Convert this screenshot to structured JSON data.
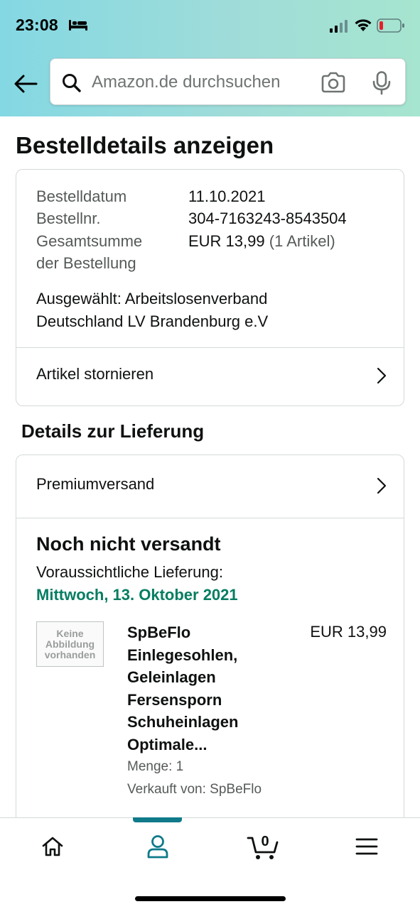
{
  "status_bar": {
    "time": "23:08"
  },
  "search": {
    "placeholder": "Amazon.de durchsuchen"
  },
  "page": {
    "title": "Bestelldetails anzeigen"
  },
  "order": {
    "date_label": "Bestelldatum",
    "date_value": "11.10.2021",
    "number_label": "Bestellnr.",
    "number_value": "304-7163243-8543504",
    "total_label_line1": "Gesamtsumme",
    "total_label_line2": "der Bestellung",
    "total_value": "EUR 13,99",
    "total_items": "(1 Artikel)",
    "selected_line1": "Ausgewählt: Arbeitslosenverband",
    "selected_line2": "Deutschland LV Brandenburg e.V",
    "cancel_link": "Artikel stornieren"
  },
  "delivery": {
    "section_title": "Details zur Lieferung",
    "shipping_method": "Premiumversand",
    "status": "Noch nicht versandt",
    "expected_label": "Voraussichtliche Lieferung:",
    "expected_date": "Mittwoch, 13. Oktober 2021"
  },
  "item": {
    "image_placeholder_line1": "Keine",
    "image_placeholder_line2": "Abbildung",
    "image_placeholder_line3": "vorhanden",
    "title_lines": [
      "SpBeFlo",
      "Einlegesohlen,",
      "Geleinlagen",
      "Fersensporn",
      "Schuheinlagen",
      "Optimale..."
    ],
    "price": "EUR 13,99",
    "quantity": "Menge: 1",
    "seller": "Verkauft von: SpBeFlo"
  },
  "bottom_nav": {
    "cart_count": "0",
    "active_tab": "account",
    "accent_color": "#0f7a8a"
  },
  "icons": [
    "bed-icon",
    "signal-icon",
    "wifi-icon",
    "battery-icon",
    "back-arrow-icon",
    "search-icon",
    "camera-icon",
    "microphone-icon",
    "chevron-right-icon",
    "home-icon",
    "account-icon",
    "cart-icon",
    "menu-icon"
  ]
}
